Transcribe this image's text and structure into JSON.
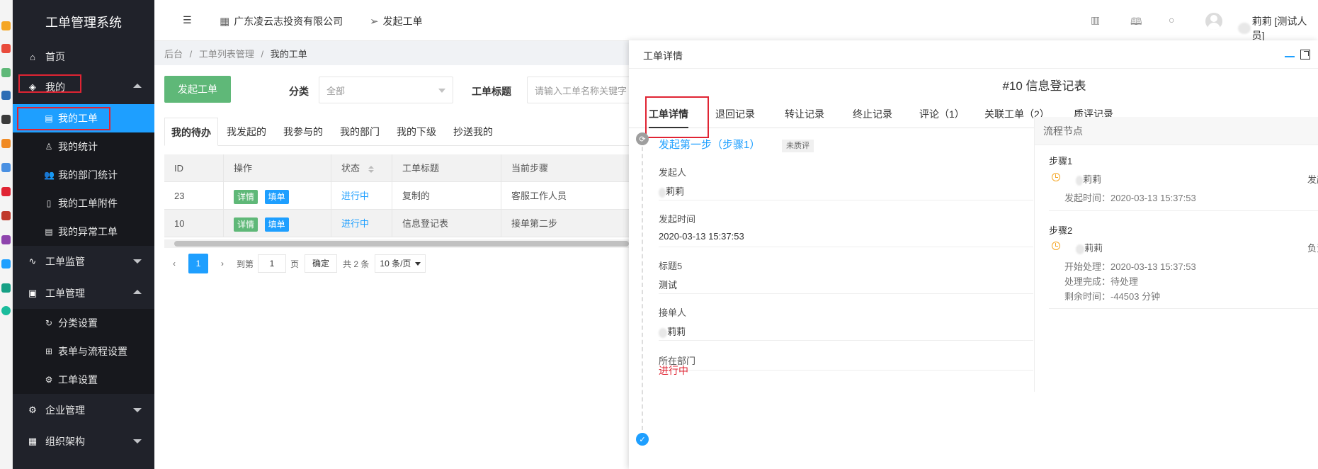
{
  "app": {
    "title": "工单管理系统"
  },
  "sidebar": {
    "home": "首页",
    "mine": "我的",
    "mine_items": [
      {
        "label": "我的工单",
        "icon": "document-icon"
      },
      {
        "label": "我的统计",
        "icon": "user-icon"
      },
      {
        "label": "我的部门统计",
        "icon": "users-icon"
      },
      {
        "label": "我的工单附件",
        "icon": "file-icon"
      },
      {
        "label": "我的异常工单",
        "icon": "document-icon"
      }
    ],
    "monitor": "工单监管",
    "manage": "工单管理",
    "manage_items": [
      {
        "label": "分类设置",
        "icon": "refresh-icon"
      },
      {
        "label": "表单与流程设置",
        "icon": "grid-icon"
      },
      {
        "label": "工单设置",
        "icon": "gear-icon"
      }
    ],
    "enterprise": "企业管理",
    "org": "组织架构"
  },
  "header": {
    "company": "广东凌云志投资有限公司",
    "create": "发起工单",
    "user": "莉莉 [测试人员]"
  },
  "breadcrumb": {
    "root": "后台",
    "sep": "/",
    "mid": "工单列表管理",
    "cur": "我的工单"
  },
  "toolbar": {
    "create_button": "发起工单",
    "category_label": "分类",
    "category_value": "全部",
    "title_label": "工单标题",
    "title_placeholder": "请输入工单名称关键字"
  },
  "tabs": [
    "我的待办",
    "我发起的",
    "我参与的",
    "我的部门",
    "我的下级",
    "抄送我的"
  ],
  "table": {
    "columns": [
      "ID",
      "操作",
      "状态",
      "工单标题",
      "当前步骤"
    ],
    "detail_btn": "详情",
    "fill_btn": "填单",
    "rows": [
      {
        "id": "23",
        "status": "进行中",
        "title": "复制的",
        "step": "客服工作人员"
      },
      {
        "id": "10",
        "status": "进行中",
        "title": "信息登记表",
        "step": "接单第二步"
      }
    ]
  },
  "pager": {
    "prev": "‹",
    "current": "1",
    "next": "›",
    "goto": "到第",
    "page_input": "1",
    "page_unit": "页",
    "confirm": "确定",
    "total": "共 2 条",
    "page_size": "10 条/页"
  },
  "drawer": {
    "title": "工单详情",
    "name": "#10 信息登记表",
    "tabs": [
      "工单详情",
      "退回记录",
      "转让记录",
      "终止记录",
      "评论（1）",
      "关联工单（2）",
      "质评记录"
    ],
    "step_title": "发起第一步（步骤1）",
    "badge": "未质评",
    "fields": [
      {
        "label": "发起人",
        "value": "莉莉"
      },
      {
        "label": "发起时间",
        "value": "2020-03-13 15:37:53"
      },
      {
        "label": "标题5",
        "value": "测试"
      },
      {
        "label": "接单人",
        "value": "莉莉"
      },
      {
        "label": "所在部门",
        "value": ""
      }
    ],
    "status": "进行中",
    "flow": {
      "title": "流程节点",
      "steps": [
        {
          "name": "步骤1",
          "person": "莉莉",
          "right": "发起",
          "lines": [
            "发起时间：2020-03-13 15:37:53"
          ]
        },
        {
          "name": "步骤2",
          "person": "莉莉",
          "right": "负责",
          "lines": [
            "开始处理：2020-03-13 15:37:53",
            "处理完成：待处理",
            "剩余时间：-44503 分钟"
          ]
        }
      ]
    }
  },
  "colors": {
    "sidebar_bg": "#20222a",
    "active_blue": "#1e9fff",
    "green": "#5fb878",
    "red_highlight": "#e02433"
  }
}
